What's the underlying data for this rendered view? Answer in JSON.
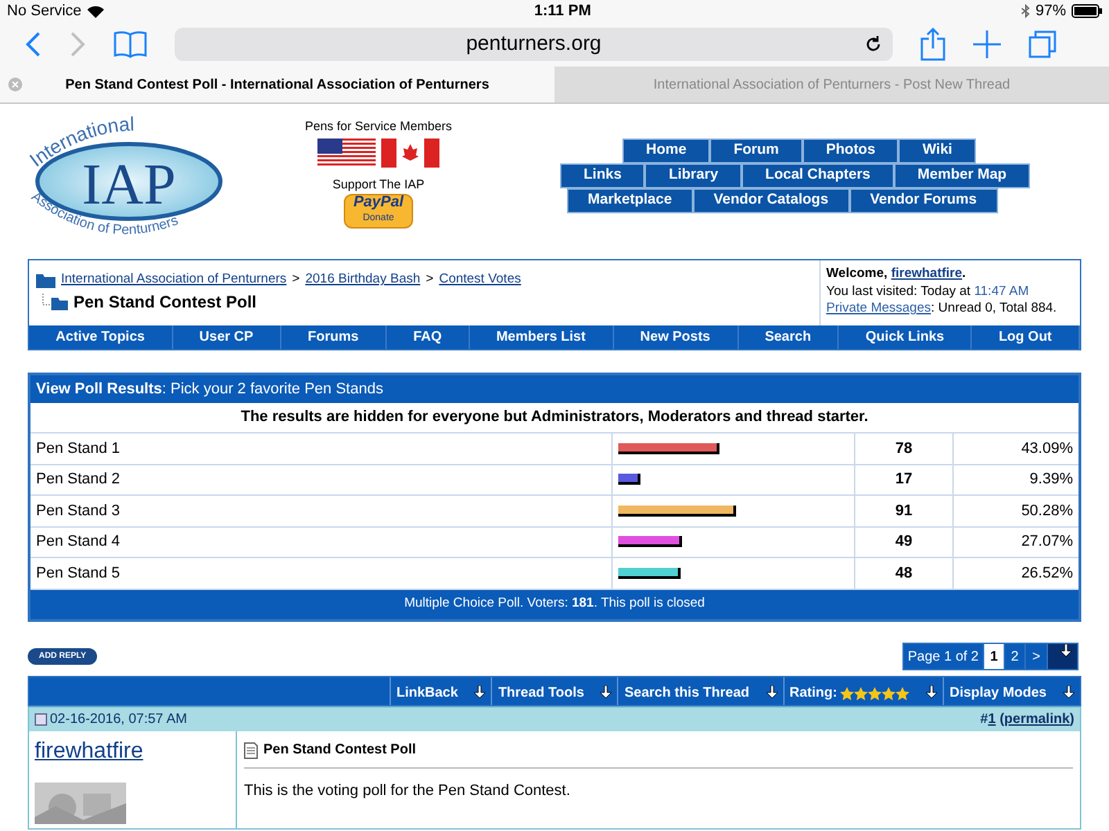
{
  "status_bar": {
    "carrier": "No Service",
    "time": "1:11 PM",
    "battery": "97%"
  },
  "browser": {
    "url": "penturners.org",
    "tabs": [
      {
        "label": "Pen Stand Contest Poll - International Association of Penturners",
        "selected": true
      },
      {
        "label": "International Association of Penturners - Post New Thread",
        "selected": false
      }
    ]
  },
  "logo": {
    "top": "International",
    "main": "IAP",
    "bottom": "Association of Penturners"
  },
  "promo": {
    "service_label": "Pens for Service Members",
    "support_label": "Support The IAP",
    "paypal": "PayPal",
    "donate": "Donate"
  },
  "site_nav": [
    [
      "Home",
      "Forum",
      "Photos",
      "Wiki"
    ],
    [
      "Links",
      "Library",
      "Local Chapters",
      "Member Map"
    ],
    [
      "Marketplace",
      "Vendor Catalogs",
      "Vendor Forums"
    ]
  ],
  "breadcrumb": {
    "links": [
      "International Association of Penturners",
      "2016 Birthday Bash",
      "Contest Votes"
    ],
    "separator": ">",
    "title": "Pen Stand Contest Poll"
  },
  "welcome": {
    "greeting": "Welcome,",
    "user": "firewhatfire",
    "last_visited": "You last visited: Today at",
    "time": "11:47 AM",
    "user_suffix": ".",
    "pm_link": "Private Messages",
    "pm_text": ": Unread 0, Total 884."
  },
  "forum_nav": [
    "Active Topics",
    "User CP",
    "Forums",
    "FAQ",
    "Members List",
    "New Posts",
    "Search",
    "Quick Links",
    "Log Out"
  ],
  "poll": {
    "title": "View Poll Results",
    "question": ": Pick your 2 favorite Pen Stands",
    "notice": "The results are hidden for everyone but Administrators, Moderators and thread starter.",
    "options": [
      {
        "label": "Pen Stand 1",
        "level": 0.4309,
        "color": "#e05a5a",
        "votes": "78",
        "percent": "43.09%"
      },
      {
        "label": "Pen Stand 2",
        "level": 0.0939,
        "color": "#5a5ae0",
        "votes": "17",
        "percent": "9.39%"
      },
      {
        "label": "Pen Stand 3",
        "level": 0.5028,
        "color": "#f0b860",
        "votes": "91",
        "percent": "50.28%"
      },
      {
        "label": "Pen Stand 4",
        "level": 0.2707,
        "color": "#e050e0",
        "votes": "49",
        "percent": "27.07%"
      },
      {
        "label": "Pen Stand 5",
        "level": 0.2652,
        "color": "#50d0d0",
        "votes": "48",
        "percent": "26.52%"
      }
    ],
    "footer": "Multiple Choice Poll. Voters: **181**. This poll is closed"
  },
  "add_reply": "ADD REPLY",
  "pagination": {
    "label": "Page 1 of 2",
    "pages": [
      {
        "label": "1",
        "selected": true
      },
      {
        "label": "2",
        "selected": false
      }
    ],
    "next": ">"
  },
  "thread_tools": [
    {
      "label": "LinkBack"
    },
    {
      "label": "Thread Tools"
    },
    {
      "label": "Search this Thread"
    },
    {
      "label": "Rating:",
      "stars": 5
    },
    {
      "label": "Display Modes"
    }
  ],
  "post": {
    "date": "02-16-2016, 07:57 AM",
    "number_prefix": "#",
    "number": "1",
    "paren_open": "(",
    "permalink": "permalink",
    "paren_close": ")",
    "author": "firewhatfire",
    "title": "Pen Stand Contest Poll",
    "body": "This is the voting poll for the Pen Stand Contest."
  }
}
